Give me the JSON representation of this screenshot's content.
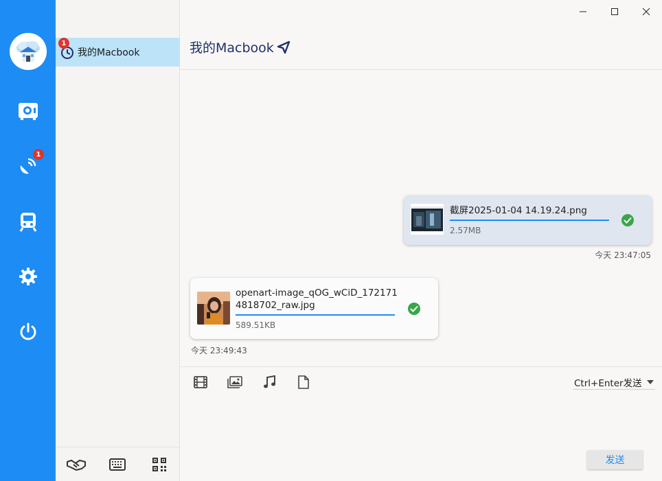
{
  "window": {
    "controls": [
      "minimize-icon",
      "maximize-icon",
      "close-icon"
    ]
  },
  "rail": {
    "accent": "#1e8cf5",
    "avatar": "cloud-house-avatar",
    "items": [
      {
        "icon": "safe-icon",
        "badge": ""
      },
      {
        "icon": "satellite-dish-icon",
        "badge": "1"
      },
      {
        "icon": "train-icon",
        "badge": ""
      },
      {
        "icon": "gear-icon",
        "badge": ""
      },
      {
        "icon": "power-icon",
        "badge": ""
      }
    ]
  },
  "devices": {
    "selected": {
      "label": "我的Macbook",
      "badge": "1"
    },
    "footer": [
      "handshake-icon",
      "keyboard-icon",
      "qr-code-icon"
    ]
  },
  "chat": {
    "title": "我的Macbook",
    "messages": [
      {
        "direction": "out",
        "file_name": "截屏2025-01-04 14.19.24.png",
        "size": "2.57MB",
        "progress": 1.0,
        "status": "done",
        "time": "今天 23:47:05"
      },
      {
        "direction": "in",
        "file_name": "openart-image_qOG_wCiD_1721714818702_raw.jpg",
        "size": "589.51KB",
        "progress": 1.0,
        "status": "done",
        "time": "今天 23:49:43"
      }
    ]
  },
  "composer": {
    "tools": [
      "film-icon",
      "image-icon",
      "music-icon",
      "file-icon"
    ],
    "send_mode": "Ctrl+Enter发送",
    "send_label": "发送"
  }
}
